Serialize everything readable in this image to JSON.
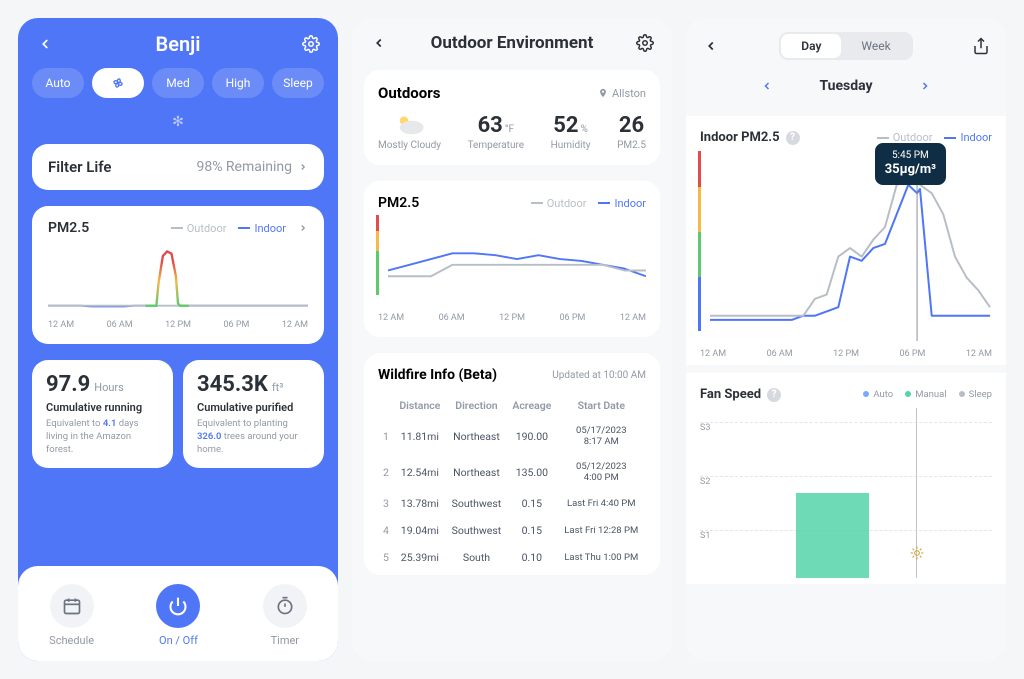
{
  "phone1": {
    "title": "Benji",
    "modes": [
      "Auto",
      "Med",
      "High",
      "Sleep"
    ],
    "fan_icon": "fan-icon",
    "filter": {
      "label": "Filter Life",
      "value": "98% Remaining"
    },
    "pm25": {
      "title": "PM2.5",
      "legend_outdoor": "Outdoor",
      "legend_indoor": "Indoor"
    },
    "x_ticks": [
      "12 AM",
      "06 AM",
      "12 PM",
      "06 PM",
      "12 AM"
    ],
    "stat_left": {
      "num": "97.9",
      "unit": "Hours",
      "sub": "Cumulative running",
      "tiny_pre": "Equivalent to ",
      "acc": "4.1",
      "tiny_post": " days living in the Amazon forest."
    },
    "stat_right": {
      "num": "345.3K",
      "unit": "ft³",
      "sub": "Cumulative purified",
      "tiny_pre": "Equivalent to planting ",
      "acc": "326.0",
      "tiny_post": " trees around your home."
    },
    "bottom": {
      "schedule": "Schedule",
      "onoff": "On / Off",
      "timer": "Timer"
    }
  },
  "phone2": {
    "title": "Outdoor Environment",
    "outdoors": {
      "title": "Outdoors",
      "location": "Allston",
      "condition": "Mostly Cloudy",
      "temp": "63",
      "temp_unit": "°F",
      "temp_label": "Temperature",
      "humidity": "52",
      "humidity_unit": "%",
      "humidity_label": "Humidity",
      "pm": "26",
      "pm_label": "PM2.5"
    },
    "pm25": {
      "title": "PM2.5",
      "legend_outdoor": "Outdoor",
      "legend_indoor": "Indoor"
    },
    "x_ticks": [
      "12 AM",
      "06 AM",
      "12 PM",
      "06 PM",
      "12 AM"
    ],
    "wildfire": {
      "title": "Wildfire Info (Beta)",
      "updated": "Updated at 10:00 AM",
      "headers": [
        "Distance",
        "Direction",
        "Acreage",
        "Start Date"
      ],
      "rows": [
        {
          "n": "1",
          "distance": "11.81mi",
          "direction": "Northeast",
          "acreage": "190.00",
          "date": "05/17/2023, 8:17 AM"
        },
        {
          "n": "2",
          "distance": "12.54mi",
          "direction": "Northeast",
          "acreage": "135.00",
          "date": "05/12/2023, 4:00 PM"
        },
        {
          "n": "3",
          "distance": "13.78mi",
          "direction": "Southwest",
          "acreage": "0.15",
          "date": "Last Fri 4:40 PM"
        },
        {
          "n": "4",
          "distance": "19.04mi",
          "direction": "Southwest",
          "acreage": "0.15",
          "date": "Last Fri 12:28 PM"
        },
        {
          "n": "5",
          "distance": "25.39mi",
          "direction": "South",
          "acreage": "0.10",
          "date": "Last Thu 1:00 PM"
        }
      ]
    }
  },
  "phone3": {
    "seg_day": "Day",
    "seg_week": "Week",
    "day_name": "Tuesday",
    "pm25": {
      "title": "Indoor PM2.5",
      "legend_outdoor": "Outdoor",
      "legend_indoor": "Indoor"
    },
    "tooltip": {
      "time": "5:45 PM",
      "value": "35µg/m³"
    },
    "x_ticks": [
      "12 AM",
      "06 AM",
      "12 PM",
      "06 PM",
      "12 AM"
    ],
    "fan": {
      "title": "Fan Speed",
      "legend_auto": "Auto",
      "legend_manual": "Manual",
      "legend_sleep": "Sleep"
    },
    "fan_levels": [
      "S3",
      "S2",
      "S1"
    ]
  },
  "chart_data": [
    {
      "type": "line",
      "title": "PM2.5 (Phone 1)",
      "x": [
        0,
        1,
        2,
        3,
        4,
        5,
        6,
        7,
        8,
        9,
        10,
        10.2,
        10.6,
        11,
        11.4,
        11.8,
        12,
        12.2,
        13,
        14,
        15,
        16,
        17,
        18,
        19,
        20,
        21,
        22,
        23,
        24
      ],
      "series": [
        {
          "name": "Indoor",
          "color": "#4F76F6",
          "values": [
            5,
            5,
            5,
            5,
            4,
            4,
            4,
            4,
            5,
            5,
            5,
            35,
            72,
            78,
            75,
            45,
            8,
            5,
            5,
            5,
            5,
            5,
            5,
            5,
            5,
            5,
            5,
            5,
            5,
            5
          ]
        },
        {
          "name": "Outdoor",
          "color": "#b8bec8",
          "values": [
            5,
            5,
            5,
            5,
            5,
            5,
            5,
            5,
            5,
            5,
            5,
            5,
            5,
            5,
            5,
            5,
            5,
            5,
            5,
            5,
            5,
            5,
            5,
            5,
            5,
            5,
            5,
            5,
            5,
            5
          ]
        }
      ],
      "x_ticks": [
        "12 AM",
        "06 AM",
        "12 PM",
        "06 PM",
        "12 AM"
      ],
      "ylim": [
        0,
        90
      ]
    },
    {
      "type": "line",
      "title": "PM2.5 (Phone 2)",
      "x": [
        0,
        1,
        2,
        3,
        4,
        5,
        6,
        7,
        8,
        9,
        10,
        11,
        12
      ],
      "series": [
        {
          "name": "Indoor",
          "color": "#4F76F6",
          "values": [
            17,
            20,
            23,
            26,
            26,
            25,
            23,
            25,
            23,
            22,
            20,
            18,
            14
          ]
        },
        {
          "name": "Outdoor",
          "color": "#b8bec8",
          "values": [
            14,
            14,
            14,
            20,
            20,
            20,
            20,
            20,
            20,
            20,
            20,
            17,
            17
          ]
        }
      ],
      "x_ticks": [
        "12 AM",
        "06 AM",
        "12 PM",
        "06 PM",
        "12 AM"
      ],
      "ylim": [
        0,
        45
      ]
    },
    {
      "type": "line",
      "title": "Indoor PM2.5 (Phone 3)",
      "x": [
        0,
        1,
        2,
        3,
        4,
        5,
        6,
        7,
        8,
        9,
        10,
        11,
        12,
        13,
        14,
        15,
        16,
        17,
        17.75,
        18,
        19,
        20,
        21,
        22,
        23,
        24
      ],
      "series": [
        {
          "name": "Indoor",
          "color": "#4F76F6",
          "values": [
            5,
            5,
            5,
            5,
            5,
            5,
            5,
            5,
            6,
            6,
            7,
            8,
            20,
            19,
            22,
            23,
            30,
            37,
            35,
            36,
            6,
            6,
            6,
            6,
            6,
            6
          ]
        },
        {
          "name": "Outdoor",
          "color": "#b8bec8",
          "values": [
            6,
            6,
            6,
            6,
            6,
            6,
            6,
            6,
            6,
            10,
            11,
            20,
            22,
            20,
            24,
            27,
            37,
            38,
            38,
            37,
            35,
            30,
            20,
            15,
            12,
            8
          ]
        }
      ],
      "x_ticks": [
        "12 AM",
        "06 AM",
        "12 PM",
        "06 PM",
        "12 AM"
      ],
      "ylim": [
        0,
        45
      ],
      "annotation": {
        "x": 17.75,
        "time": "5:45 PM",
        "value": "35µg/m³"
      }
    },
    {
      "type": "bar",
      "title": "Fan Speed (Phone 3)",
      "categories": [
        "12 AM",
        "06 AM",
        "12 PM",
        "06 PM",
        "12 AM"
      ],
      "bars": [
        {
          "start": 8,
          "end": 14,
          "level": "S1",
          "mode": "Manual"
        }
      ],
      "levels": [
        "S1",
        "S2",
        "S3"
      ]
    }
  ]
}
